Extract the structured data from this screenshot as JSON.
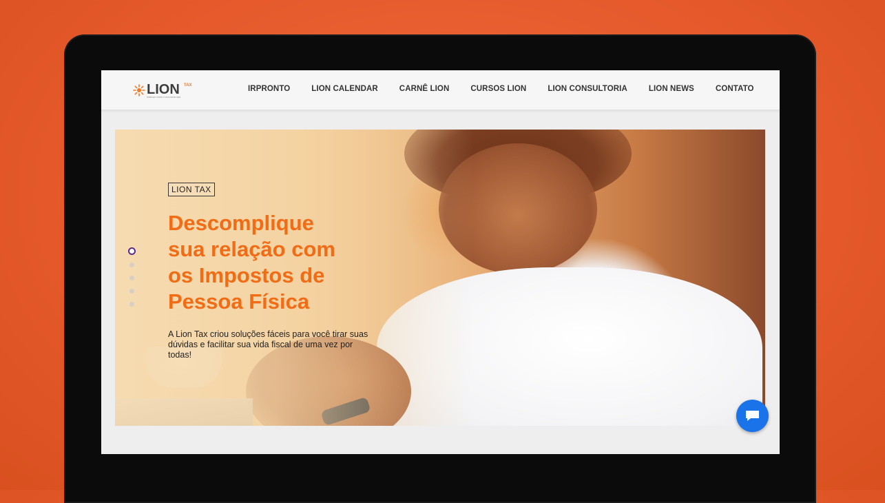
{
  "brand": {
    "logo_text": "LION",
    "logo_superscript": "TAX",
    "logo_tagline": "SIMPLES COMO A VIDA DEVE SER",
    "accent_color": "#f26b15"
  },
  "nav": {
    "items": [
      {
        "label": "IRPRONTO"
      },
      {
        "label": "LION CALENDAR"
      },
      {
        "label": "CARNÊ LION"
      },
      {
        "label": "CURSOS LION"
      },
      {
        "label": "LION CONSULTORIA"
      },
      {
        "label": "LION NEWS"
      },
      {
        "label": "CONTATO"
      }
    ]
  },
  "hero": {
    "tag": "LION TAX",
    "title_lines": [
      "Descomplique",
      "sua relação com",
      "os Impostos de",
      "Pessoa Física"
    ],
    "description": "A Lion Tax criou soluções fáceis para você tirar suas dúvidas e facilitar sua vida fiscal de uma vez por todas!",
    "slides_total": 5,
    "slide_active": 1
  },
  "chat": {
    "icon": "chat-bubble-icon",
    "color": "#1a73e8"
  }
}
